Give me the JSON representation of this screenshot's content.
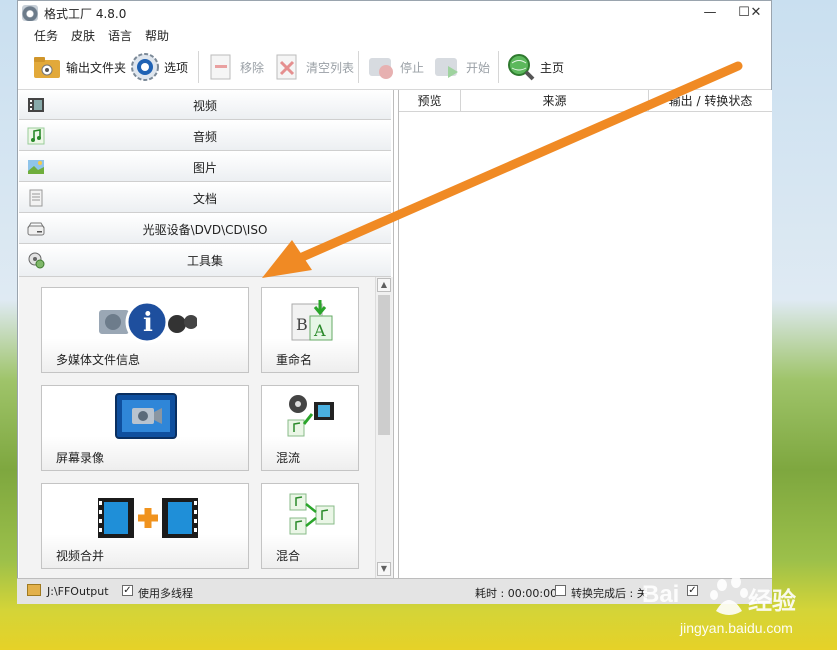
{
  "window": {
    "title": "格式工厂 4.8.0",
    "minimize": "—",
    "maximize": "☐",
    "close": "✕"
  },
  "menu": [
    "任务",
    "皮肤",
    "语言",
    "帮助"
  ],
  "toolbar": {
    "output_folder": "输出文件夹",
    "options": "选项",
    "remove": "移除",
    "clear_list": "清空列表",
    "stop": "停止",
    "start": "开始",
    "home": "主页"
  },
  "categories": [
    {
      "label": "视频",
      "icon": "film-icon"
    },
    {
      "label": "音频",
      "icon": "music-note-icon"
    },
    {
      "label": "图片",
      "icon": "picture-icon"
    },
    {
      "label": "文档",
      "icon": "document-icon"
    },
    {
      "label": "光驱设备\\DVD\\CD\\ISO",
      "icon": "disc-drive-icon"
    },
    {
      "label": "工具集",
      "icon": "toolbox-icon"
    }
  ],
  "tools": [
    {
      "label": "多媒体文件信息",
      "icon": "media-info-icon"
    },
    {
      "label": "重命名",
      "icon": "rename-icon"
    },
    {
      "label": "屏幕录像",
      "icon": "screen-record-icon"
    },
    {
      "label": "混流",
      "icon": "mux-icon"
    },
    {
      "label": "视频合并",
      "icon": "video-join-icon"
    },
    {
      "label": "混合",
      "icon": "audio-mix-icon"
    }
  ],
  "task_columns": [
    "预览",
    "来源",
    "输出 / 转换状态"
  ],
  "status": {
    "output_path": "J:\\FFOutput",
    "multithread_label": "使用多线程",
    "multithread_checked": "✓",
    "elapsed": "耗时 : 00:00:00",
    "after_done": "转换完成后 : 关",
    "third_checked": "✓"
  },
  "watermark": {
    "brand_left": "Bai",
    "brand_right": "经验",
    "url": "jingyan.baidu.com"
  },
  "colors": {
    "annotation_arrow": "#f08a24",
    "window_border": "#9aa4ae"
  }
}
